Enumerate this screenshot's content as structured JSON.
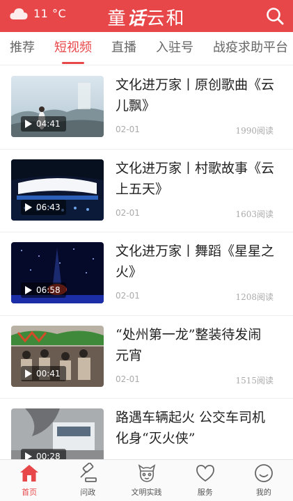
{
  "header": {
    "weather_icon": "cloud-icon",
    "temperature": "11 °C",
    "brand_part1": "童",
    "brand_part2": "话",
    "brand_part3": "云和",
    "search_icon": "search-icon",
    "background_color": "#e8474a"
  },
  "tabs": [
    {
      "label": "推荐",
      "active": false
    },
    {
      "label": "短视频",
      "active": true
    },
    {
      "label": "直播",
      "active": false
    },
    {
      "label": "入驻号",
      "active": false
    },
    {
      "label": "战疫求助平台",
      "active": false
    }
  ],
  "videos": [
    {
      "title": "文化进万家丨原创歌曲《云儿飘》",
      "duration": "04:41",
      "date": "02-01",
      "views": "1990阅读"
    },
    {
      "title": "文化进万家丨村歌故事《云上五天》",
      "duration": "06:43",
      "date": "02-01",
      "views": "1603阅读"
    },
    {
      "title": "文化进万家丨舞蹈《星星之火》",
      "duration": "06:58",
      "date": "02-01",
      "views": "1208阅读"
    },
    {
      "title": "“处州第一龙”整装待发闹元宵",
      "duration": "00:41",
      "date": "02-01",
      "views": "1515阅读"
    },
    {
      "title": "路遇车辆起火 公交车司机化身“灭火侠”",
      "duration": "00:28",
      "date": "",
      "views": ""
    }
  ],
  "bottom_nav": [
    {
      "label": "首页",
      "icon": "home-icon",
      "active": true
    },
    {
      "label": "问政",
      "icon": "gavel-icon",
      "active": false
    },
    {
      "label": "文明实践",
      "icon": "mascot-icon",
      "active": false
    },
    {
      "label": "服务",
      "icon": "heart-icon",
      "active": false
    },
    {
      "label": "我的",
      "icon": "smiley-icon",
      "active": false
    }
  ],
  "accent_color": "#e8474a"
}
